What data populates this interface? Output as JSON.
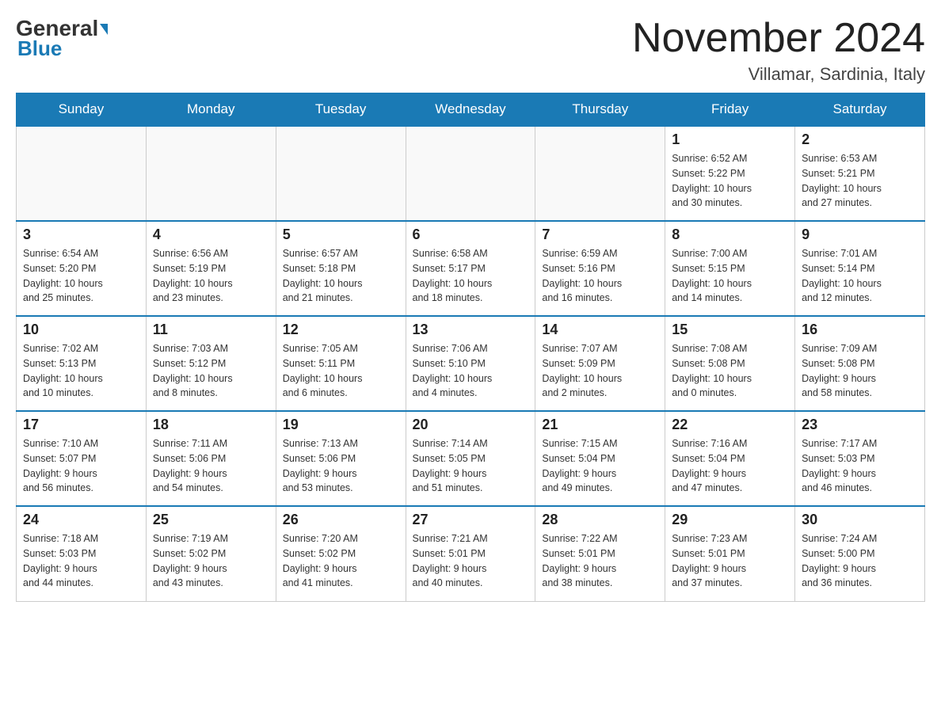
{
  "logo": {
    "general": "General",
    "blue": "Blue",
    "arrow": true
  },
  "title": "November 2024",
  "location": "Villamar, Sardinia, Italy",
  "days_of_week": [
    "Sunday",
    "Monday",
    "Tuesday",
    "Wednesday",
    "Thursday",
    "Friday",
    "Saturday"
  ],
  "weeks": [
    [
      {
        "day": "",
        "info": ""
      },
      {
        "day": "",
        "info": ""
      },
      {
        "day": "",
        "info": ""
      },
      {
        "day": "",
        "info": ""
      },
      {
        "day": "",
        "info": ""
      },
      {
        "day": "1",
        "info": "Sunrise: 6:52 AM\nSunset: 5:22 PM\nDaylight: 10 hours\nand 30 minutes."
      },
      {
        "day": "2",
        "info": "Sunrise: 6:53 AM\nSunset: 5:21 PM\nDaylight: 10 hours\nand 27 minutes."
      }
    ],
    [
      {
        "day": "3",
        "info": "Sunrise: 6:54 AM\nSunset: 5:20 PM\nDaylight: 10 hours\nand 25 minutes."
      },
      {
        "day": "4",
        "info": "Sunrise: 6:56 AM\nSunset: 5:19 PM\nDaylight: 10 hours\nand 23 minutes."
      },
      {
        "day": "5",
        "info": "Sunrise: 6:57 AM\nSunset: 5:18 PM\nDaylight: 10 hours\nand 21 minutes."
      },
      {
        "day": "6",
        "info": "Sunrise: 6:58 AM\nSunset: 5:17 PM\nDaylight: 10 hours\nand 18 minutes."
      },
      {
        "day": "7",
        "info": "Sunrise: 6:59 AM\nSunset: 5:16 PM\nDaylight: 10 hours\nand 16 minutes."
      },
      {
        "day": "8",
        "info": "Sunrise: 7:00 AM\nSunset: 5:15 PM\nDaylight: 10 hours\nand 14 minutes."
      },
      {
        "day": "9",
        "info": "Sunrise: 7:01 AM\nSunset: 5:14 PM\nDaylight: 10 hours\nand 12 minutes."
      }
    ],
    [
      {
        "day": "10",
        "info": "Sunrise: 7:02 AM\nSunset: 5:13 PM\nDaylight: 10 hours\nand 10 minutes."
      },
      {
        "day": "11",
        "info": "Sunrise: 7:03 AM\nSunset: 5:12 PM\nDaylight: 10 hours\nand 8 minutes."
      },
      {
        "day": "12",
        "info": "Sunrise: 7:05 AM\nSunset: 5:11 PM\nDaylight: 10 hours\nand 6 minutes."
      },
      {
        "day": "13",
        "info": "Sunrise: 7:06 AM\nSunset: 5:10 PM\nDaylight: 10 hours\nand 4 minutes."
      },
      {
        "day": "14",
        "info": "Sunrise: 7:07 AM\nSunset: 5:09 PM\nDaylight: 10 hours\nand 2 minutes."
      },
      {
        "day": "15",
        "info": "Sunrise: 7:08 AM\nSunset: 5:08 PM\nDaylight: 10 hours\nand 0 minutes."
      },
      {
        "day": "16",
        "info": "Sunrise: 7:09 AM\nSunset: 5:08 PM\nDaylight: 9 hours\nand 58 minutes."
      }
    ],
    [
      {
        "day": "17",
        "info": "Sunrise: 7:10 AM\nSunset: 5:07 PM\nDaylight: 9 hours\nand 56 minutes."
      },
      {
        "day": "18",
        "info": "Sunrise: 7:11 AM\nSunset: 5:06 PM\nDaylight: 9 hours\nand 54 minutes."
      },
      {
        "day": "19",
        "info": "Sunrise: 7:13 AM\nSunset: 5:06 PM\nDaylight: 9 hours\nand 53 minutes."
      },
      {
        "day": "20",
        "info": "Sunrise: 7:14 AM\nSunset: 5:05 PM\nDaylight: 9 hours\nand 51 minutes."
      },
      {
        "day": "21",
        "info": "Sunrise: 7:15 AM\nSunset: 5:04 PM\nDaylight: 9 hours\nand 49 minutes."
      },
      {
        "day": "22",
        "info": "Sunrise: 7:16 AM\nSunset: 5:04 PM\nDaylight: 9 hours\nand 47 minutes."
      },
      {
        "day": "23",
        "info": "Sunrise: 7:17 AM\nSunset: 5:03 PM\nDaylight: 9 hours\nand 46 minutes."
      }
    ],
    [
      {
        "day": "24",
        "info": "Sunrise: 7:18 AM\nSunset: 5:03 PM\nDaylight: 9 hours\nand 44 minutes."
      },
      {
        "day": "25",
        "info": "Sunrise: 7:19 AM\nSunset: 5:02 PM\nDaylight: 9 hours\nand 43 minutes."
      },
      {
        "day": "26",
        "info": "Sunrise: 7:20 AM\nSunset: 5:02 PM\nDaylight: 9 hours\nand 41 minutes."
      },
      {
        "day": "27",
        "info": "Sunrise: 7:21 AM\nSunset: 5:01 PM\nDaylight: 9 hours\nand 40 minutes."
      },
      {
        "day": "28",
        "info": "Sunrise: 7:22 AM\nSunset: 5:01 PM\nDaylight: 9 hours\nand 38 minutes."
      },
      {
        "day": "29",
        "info": "Sunrise: 7:23 AM\nSunset: 5:01 PM\nDaylight: 9 hours\nand 37 minutes."
      },
      {
        "day": "30",
        "info": "Sunrise: 7:24 AM\nSunset: 5:00 PM\nDaylight: 9 hours\nand 36 minutes."
      }
    ]
  ]
}
